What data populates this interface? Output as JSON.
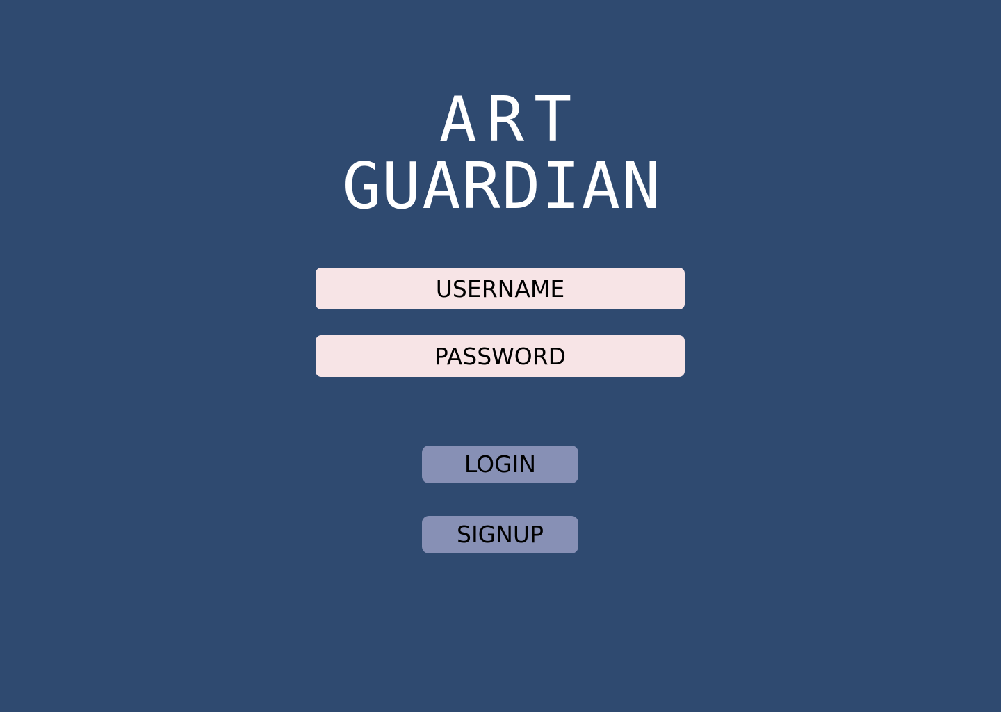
{
  "app": {
    "title_line_1": "ART",
    "title_line_2": "GUARDIAN"
  },
  "form": {
    "username": {
      "placeholder": "USERNAME",
      "value": ""
    },
    "password": {
      "placeholder": "PASSWORD",
      "value": ""
    }
  },
  "actions": {
    "login_label": "LOGIN",
    "signup_label": "SIGNUP"
  },
  "colors": {
    "background": "#2f4a70",
    "field_background": "#f7e4e6",
    "button_background": "#8790b5",
    "title_text": "#ffffff",
    "body_text": "#000000"
  }
}
